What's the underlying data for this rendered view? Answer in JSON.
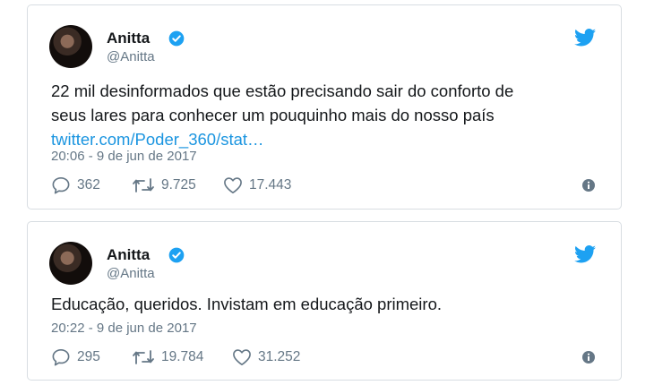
{
  "tweets": [
    {
      "author": "Anitta",
      "handle": "@Anitta",
      "text_lines": [
        "22 mil desinformados que estão precisando sair do conforto de",
        "seus lares para conhecer um pouquinho mais do nosso país"
      ],
      "link": "twitter.com/Poder_360/stat…",
      "timestamp": "20:06 - 9 de jun de 2017",
      "replies": "362",
      "retweets": "9.725",
      "likes": "17.443"
    },
    {
      "author": "Anitta",
      "handle": "@Anitta",
      "text_lines": [
        "Educação, queridos. Invistam em educação primeiro."
      ],
      "timestamp": "20:22 - 9 de jun de 2017",
      "replies": "295",
      "retweets": "19.784",
      "likes": "31.252"
    }
  ],
  "icons": {
    "brand": "twitter-bird-icon",
    "verified": "verified-badge-icon",
    "reply": "reply-icon",
    "retweet": "retweet-icon",
    "like": "heart-icon",
    "info": "info-icon"
  },
  "colors": {
    "brand_blue": "#1da1f2",
    "link_blue": "#1b95e0",
    "meta_gray": "#657786",
    "text": "#14171a"
  }
}
